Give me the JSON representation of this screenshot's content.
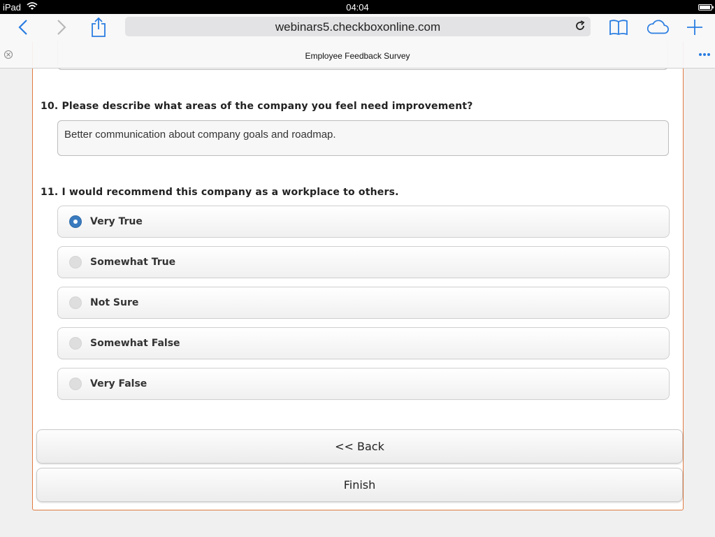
{
  "status_bar": {
    "carrier": "iPad",
    "time": "04:04",
    "battery_level": 0.95
  },
  "browser": {
    "url": "webinars5.checkboxonline.com",
    "tab_title": "Employee Feedback Survey",
    "accent_color": "#2a7de1",
    "icons": [
      "back-icon",
      "forward-icon",
      "share-icon",
      "reload-icon",
      "bookmarks-icon",
      "icloud-tabs-icon",
      "new-tab-icon",
      "close-tab-icon",
      "more-icon"
    ]
  },
  "survey": {
    "q10": {
      "question": "10. Please describe what areas of the company you feel need improvement?",
      "answer": "Better communication about company goals and roadmap."
    },
    "q11": {
      "question": "11. I would recommend this company as a workplace to others.",
      "options": [
        {
          "label": "Very True",
          "selected": true
        },
        {
          "label": "Somewhat True",
          "selected": false
        },
        {
          "label": "Not Sure",
          "selected": false
        },
        {
          "label": "Somewhat False",
          "selected": false
        },
        {
          "label": "Very False",
          "selected": false
        }
      ]
    },
    "back_label": "<< Back",
    "finish_label": "Finish",
    "panel_border_color": "#e07a40",
    "radio_selected_color": "#3a7bbf"
  }
}
